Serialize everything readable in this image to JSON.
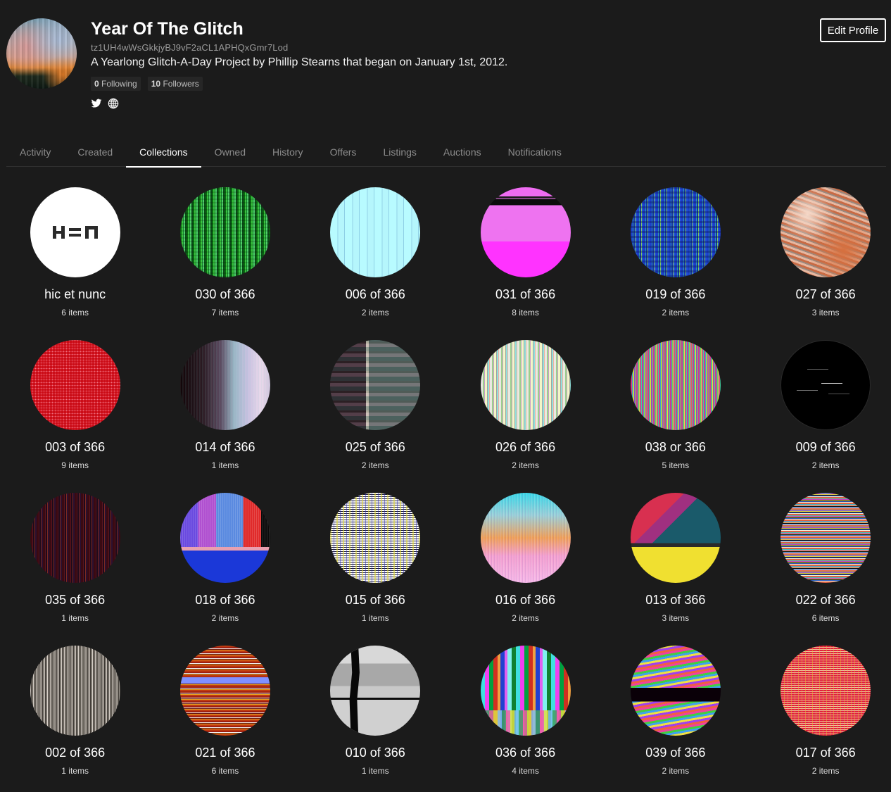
{
  "profile": {
    "name": "Year Of The Glitch",
    "address": "tz1UH4wWsGkkjyBJ9vF2aCL1APHQxGmr7Lod",
    "bio": "A Yearlong Glitch-A-Day Project by Phillip Stearns that began on January 1st, 2012.",
    "following_count": "0",
    "following_label": "Following",
    "followers_count": "10",
    "followers_label": "Followers",
    "social_icons": [
      "twitter-icon",
      "globe-icon"
    ],
    "edit_button": "Edit Profile"
  },
  "tabs": [
    {
      "label": "Activity",
      "active": false
    },
    {
      "label": "Created",
      "active": false
    },
    {
      "label": "Collections",
      "active": true
    },
    {
      "label": "Owned",
      "active": false
    },
    {
      "label": "History",
      "active": false
    },
    {
      "label": "Offers",
      "active": false
    },
    {
      "label": "Listings",
      "active": false
    },
    {
      "label": "Auctions",
      "active": false
    },
    {
      "label": "Notifications",
      "active": false
    }
  ],
  "collections": [
    {
      "title": "hic et nunc",
      "count": "6 items",
      "thumb": "hen"
    },
    {
      "title": "030 of 366",
      "count": "7 items",
      "thumb": "030"
    },
    {
      "title": "006 of 366",
      "count": "2 items",
      "thumb": "006"
    },
    {
      "title": "031 of 366",
      "count": "8 items",
      "thumb": "031"
    },
    {
      "title": "019 of 366",
      "count": "2 items",
      "thumb": "019"
    },
    {
      "title": "027 of 366",
      "count": "3 items",
      "thumb": "027"
    },
    {
      "title": "003 of 366",
      "count": "9 items",
      "thumb": "003"
    },
    {
      "title": "014 of 366",
      "count": "1 items",
      "thumb": "014"
    },
    {
      "title": "025 of 366",
      "count": "2 items",
      "thumb": "025"
    },
    {
      "title": "026 of 366",
      "count": "2 items",
      "thumb": "026"
    },
    {
      "title": "038 or 366",
      "count": "5 items",
      "thumb": "038"
    },
    {
      "title": "009 of 366",
      "count": "2 items",
      "thumb": "009"
    },
    {
      "title": "035 of 366",
      "count": "1 items",
      "thumb": "035"
    },
    {
      "title": "018 of 366",
      "count": "2 items",
      "thumb": "018"
    },
    {
      "title": "015 of 366",
      "count": "1 items",
      "thumb": "015"
    },
    {
      "title": "016 of 366",
      "count": "2 items",
      "thumb": "016"
    },
    {
      "title": "013 of 366",
      "count": "3 items",
      "thumb": "013"
    },
    {
      "title": "022 of 366",
      "count": "6 items",
      "thumb": "022"
    },
    {
      "title": "002 of 366",
      "count": "1 items",
      "thumb": "002"
    },
    {
      "title": "021 of 366",
      "count": "6 items",
      "thumb": "021"
    },
    {
      "title": "010 of 366",
      "count": "1 items",
      "thumb": "010"
    },
    {
      "title": "036 of 366",
      "count": "4 items",
      "thumb": "036"
    },
    {
      "title": "039 of 366",
      "count": "2 items",
      "thumb": "039"
    },
    {
      "title": "017 of 366",
      "count": "2 items",
      "thumb": "017"
    }
  ]
}
